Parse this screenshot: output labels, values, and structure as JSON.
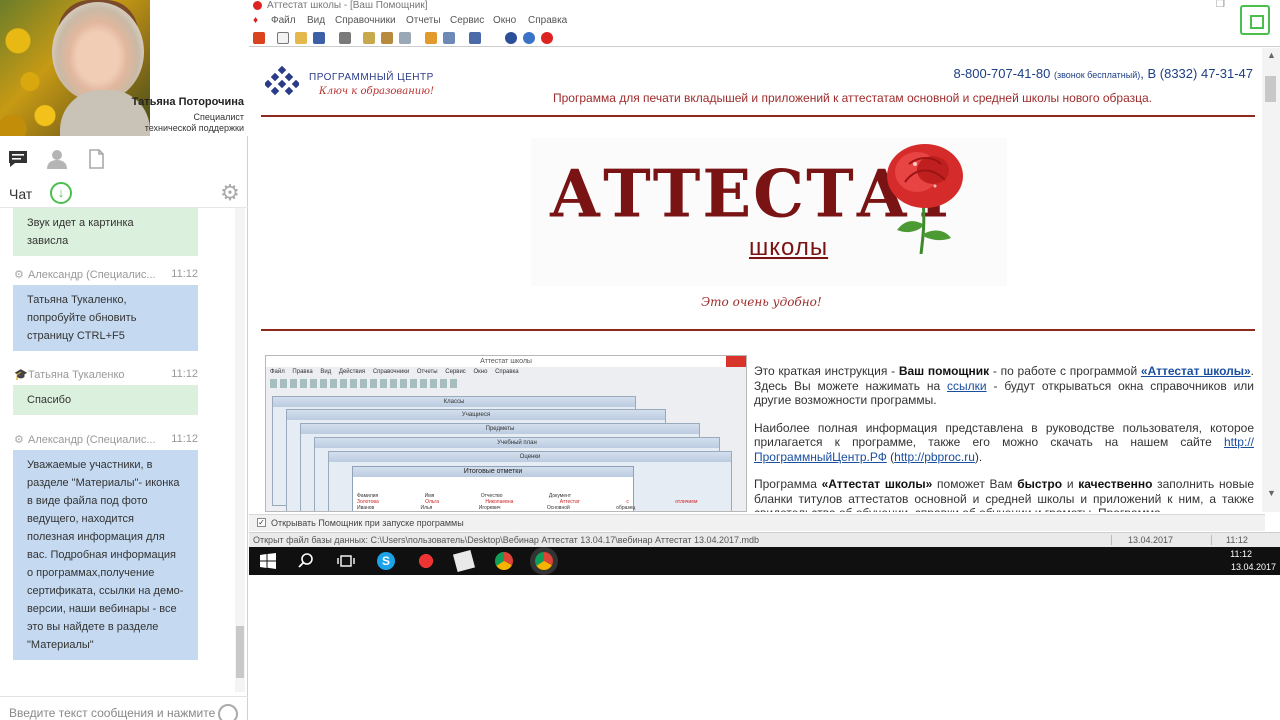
{
  "presenter": {
    "name": "Татьяна Поторочина",
    "role_line1": "Специалист",
    "role_line2": "технической поддержки"
  },
  "chat": {
    "label": "Чат",
    "input_placeholder": "Введите текст сообщения и нажмите",
    "messages": [
      {
        "author": "",
        "time": "",
        "text_line1": "Звук идет а картинка",
        "text_line2": "зависла"
      },
      {
        "author": "Александр (Специалис...",
        "time": "11:12",
        "text": "Татьяна Тукаленко, попробуйте обновить страницу CTRL+F5"
      },
      {
        "author": "Татьяна Тукаленко",
        "time": "11:12",
        "text": "Спасибо"
      },
      {
        "author": "Александр (Специалис...",
        "time": "11:12",
        "text": "Уважаемые участники, в разделе \"Материалы\"- иконка в виде файла под фото ведущего, находится полезная информация для вас. Подробная информация о программах,получение сертификата, ссылки на демо-версии, наши вебинары - все это вы найдете в разделе \"Материалы\""
      }
    ]
  },
  "window": {
    "title": "Аттестат школы - [Ваш Помощник]",
    "menu": [
      "Файл",
      "Вид",
      "Справочники",
      "Отчеты",
      "Сервис",
      "Окно",
      "Справка"
    ]
  },
  "page": {
    "logo_name": "ПРОГРАММНЫЙ ЦЕНТР",
    "logo_slogan": "Ключ к образованию!",
    "phone_main": "8-800-707-41-80",
    "phone_free": "(звонок бесплатный)",
    "phone_second": ", В (8332) 47-31-47",
    "tagline": "Программа для печати вкладышей и приложений к аттестатам основной и средней школы нового образца.",
    "hero_title": "АТТЕСТАТ",
    "hero_sub": "школы",
    "hero_slogan": "Это очень удобно!",
    "desc_p1_a": "Это краткая инструкция - ",
    "desc_p1_b": "Ваш помощник",
    "desc_p1_c": " - по работе с программой ",
    "desc_p1_d": "«Аттестат школы»",
    "desc_p1_e": ". Здесь Вы можете нажимать на ",
    "desc_p1_f": "ссылки",
    "desc_p1_g": " - будут открываться окна справочников или другие возможности программы.",
    "desc_p2_a": "Наиболее полная информация представлена в руководстве пользователя, которое прилагается к программе, также его можно скачать на нашем сайте ",
    "desc_p2_b": "http://ПрограммныйЦентр.РФ",
    "desc_p2_c": " (",
    "desc_p2_d": "http://pbproc.ru",
    "desc_p2_e": ").",
    "desc_p3_a": "Программа ",
    "desc_p3_b": "«Аттестат школы»",
    "desc_p3_c": " поможет Вам ",
    "desc_p3_d": "быстро",
    "desc_p3_e": " и ",
    "desc_p3_f": "качественно",
    "desc_p3_g": " заполнить новые бланки титулов аттестатов основной и средней школы и приложений к ним, а также свидетельства об обучении, справки об обучении и грамоты. Программа"
  },
  "embedded_shot": {
    "title": "Аттестат школы",
    "menu": "Файл Правка Вид Действия Справочники Отчеты Сервис Окно Справка",
    "windows": [
      "Классы",
      "Учащиеся",
      "Предметы",
      "Учебный план",
      "Оценки"
    ],
    "final_title": "Итоговые отметки",
    "cols": "Фамилия Имя Отчество Документ",
    "row1": "Золотова Ольга Николаевна Аттестат с отличием",
    "row2": "Иванов Илья Игоревич Основной образец"
  },
  "checkbox_label": "Открывать Помощник при запуске программы",
  "status": {
    "text": "Открыт файл базы данных: C:\\Users\\пользователь\\Desktop\\Вебинар Аттестат 13.04.17\\вебинар Аттестат 13.04.2017.mdb",
    "date": "13.04.2017",
    "time": "11:12"
  },
  "taskbar": {
    "time": "11:12",
    "date": "13.04.2017"
  },
  "colors": {
    "accent_green": "#4bbf4e",
    "bubble_green": "#dcf1dd",
    "bubble_blue": "#c5daf1",
    "brand_red": "#7a1414",
    "link_blue": "#1a4fa0"
  }
}
